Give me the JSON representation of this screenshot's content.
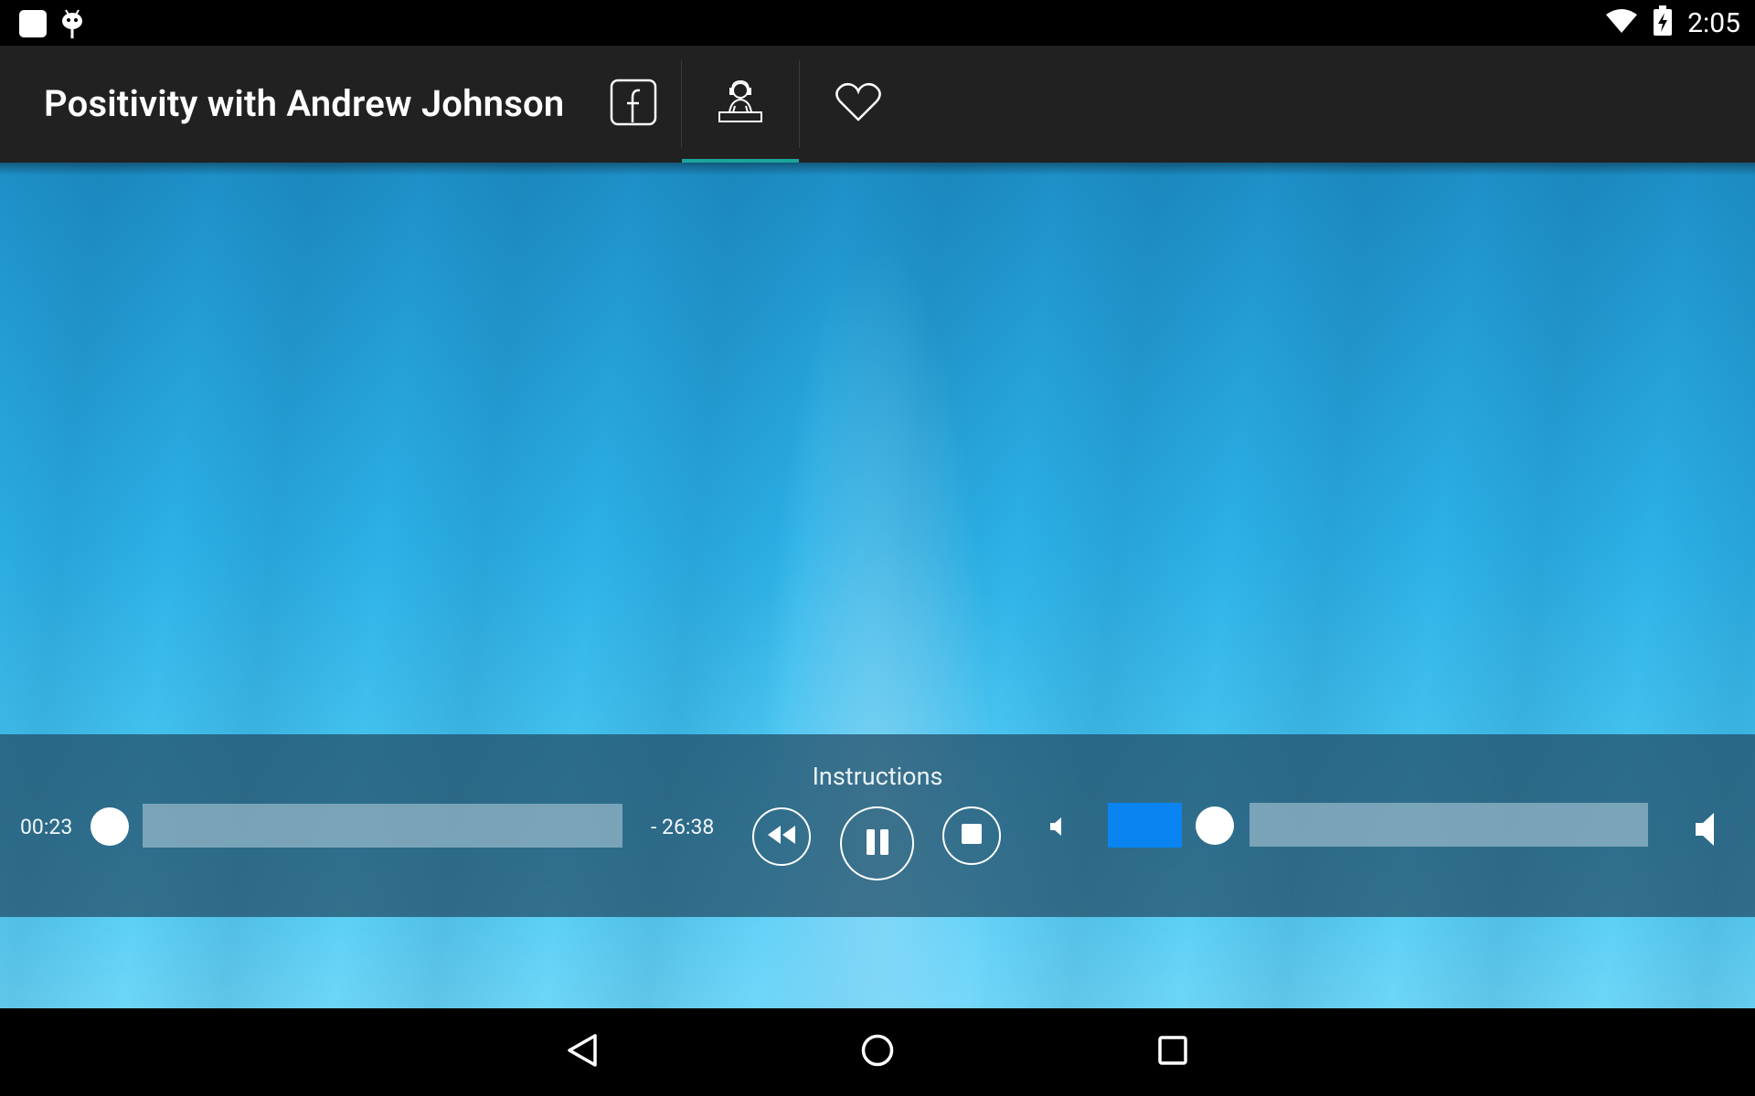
{
  "status_bar": {
    "time": "2:05",
    "icons": [
      "app-notification-icon",
      "android-debug-icon",
      "wifi-icon",
      "battery-charging-icon"
    ]
  },
  "app_bar": {
    "title": "Positivity with Andrew Johnson",
    "tabs": [
      {
        "icon": "facebook-icon",
        "selected": false
      },
      {
        "icon": "dj-icon",
        "selected": true
      },
      {
        "icon": "heart-icon",
        "selected": false
      }
    ],
    "accent_color": "#1aa59a"
  },
  "player": {
    "track_title": "Instructions",
    "elapsed": "00:23",
    "remaining": "- 26:38",
    "progress": 0.014,
    "volume": 0.0,
    "controls": [
      "rewind-icon",
      "pause-icon",
      "stop-icon"
    ],
    "volume_color": "#0a84f0"
  },
  "nav_bar": {
    "buttons": [
      "back-icon",
      "home-icon",
      "recents-icon"
    ]
  }
}
